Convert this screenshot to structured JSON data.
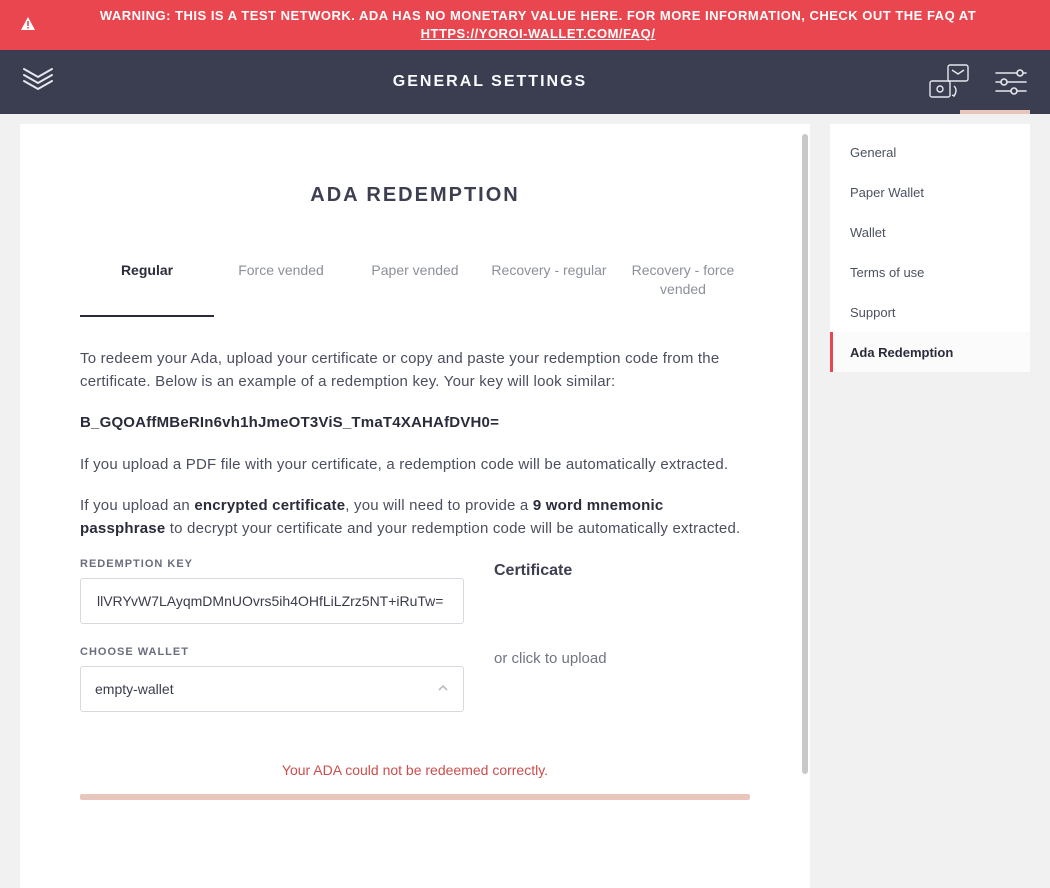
{
  "warning": {
    "text_before_link": "WARNING: THIS IS A TEST NETWORK. ADA HAS NO MONETARY VALUE HERE. FOR MORE INFORMATION, CHECK OUT THE FAQ AT ",
    "link_text": "HTTPS://YOROI-WALLET.COM/FAQ/"
  },
  "header": {
    "title": "GENERAL SETTINGS"
  },
  "sidenav": {
    "items": [
      {
        "label": "General"
      },
      {
        "label": "Paper Wallet"
      },
      {
        "label": "Wallet"
      },
      {
        "label": "Terms of use"
      },
      {
        "label": "Support"
      },
      {
        "label": "Ada Redemption"
      }
    ],
    "active_index": 5
  },
  "panel": {
    "title": "ADA REDEMPTION",
    "tabs": [
      {
        "label": "Regular"
      },
      {
        "label": "Force vended"
      },
      {
        "label": "Paper vended"
      },
      {
        "label": "Recovery - regular"
      },
      {
        "label": "Recovery - force vended"
      }
    ],
    "active_tab_index": 0,
    "intro_p1": "To redeem your Ada, upload your certificate or copy and paste your redemption code from the certificate. Below is an example of a redemption key. Your key will look similar:",
    "example_key": "B_GQOAffMBeRIn6vh1hJmeOT3ViS_TmaT4XAHAfDVH0=",
    "intro_p2": "If you upload a PDF file with your certificate, a redemption code will be automatically extracted.",
    "intro_p3_a": "If you upload an ",
    "intro_p3_bold1": "encrypted certificate",
    "intro_p3_b": ", you will need to provide a ",
    "intro_p3_bold2": "9 word mnemonic passphrase",
    "intro_p3_c": " to decrypt your certificate and your redemption code will be automatically extracted.",
    "form": {
      "redemption_key_label": "REDEMPTION KEY",
      "redemption_key_value": "llVRYvW7LAyqmDMnUOvrs5ih4OHfLiLZrz5NT+iRuTw=",
      "choose_wallet_label": "CHOOSE WALLET",
      "choose_wallet_value": "empty-wallet",
      "certificate_title": "Certificate",
      "upload_hint": "or click to upload"
    },
    "error": "Your ADA could not be redeemed correctly."
  },
  "colors": {
    "warn_bg": "#e9464f",
    "dark_bg": "#3b3e50",
    "accent_pink": "#e8c6bc",
    "accent_red": "#cc4d4d"
  }
}
